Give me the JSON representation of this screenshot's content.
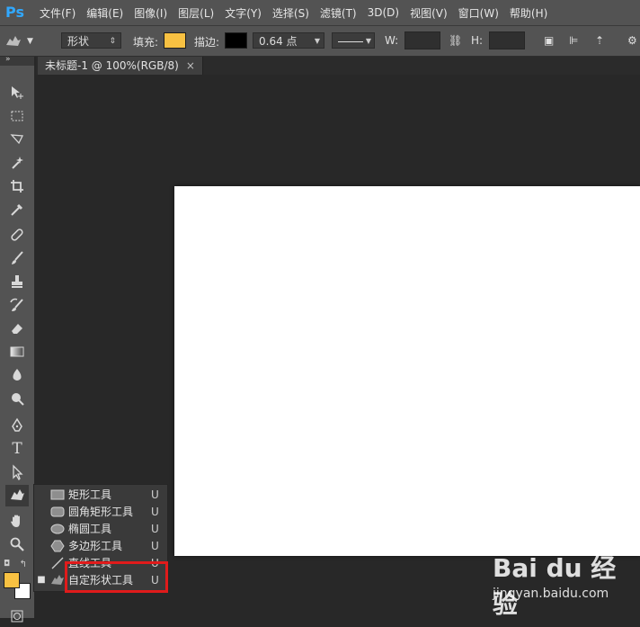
{
  "app": {
    "logo": "Ps"
  },
  "menu": [
    "文件(F)",
    "编辑(E)",
    "图像(I)",
    "图层(L)",
    "文字(Y)",
    "选择(S)",
    "滤镜(T)",
    "3D(D)",
    "视图(V)",
    "窗口(W)",
    "帮助(H)"
  ],
  "options": {
    "mode": "形状",
    "fill_label": "填充:",
    "fill_color": "#f8c142",
    "stroke_label": "描边:",
    "stroke_color": "#000000",
    "stroke_width": "0.64 点",
    "w_label": "W:",
    "h_label": "H:"
  },
  "document": {
    "tab_title": "未标题-1 @ 100%(RGB/8)",
    "close": "×"
  },
  "flyout": {
    "items": [
      {
        "label": "矩形工具",
        "key": "U",
        "icon": "rectangle-icon"
      },
      {
        "label": "圆角矩形工具",
        "key": "U",
        "icon": "rounded-rectangle-icon"
      },
      {
        "label": "椭圆工具",
        "key": "U",
        "icon": "ellipse-icon"
      },
      {
        "label": "多边形工具",
        "key": "U",
        "icon": "polygon-icon"
      },
      {
        "label": "直线工具",
        "key": "U",
        "icon": "line-icon"
      },
      {
        "label": "自定形状工具",
        "key": "U",
        "icon": "custom-shape-icon",
        "selected": true
      }
    ]
  },
  "colors": {
    "foreground": "#f8c142",
    "background": "#ffffff",
    "highlight": "#e01b1b"
  },
  "watermark": {
    "logo": "Bai du 经验",
    "site": "jingyan.baidu.com"
  }
}
